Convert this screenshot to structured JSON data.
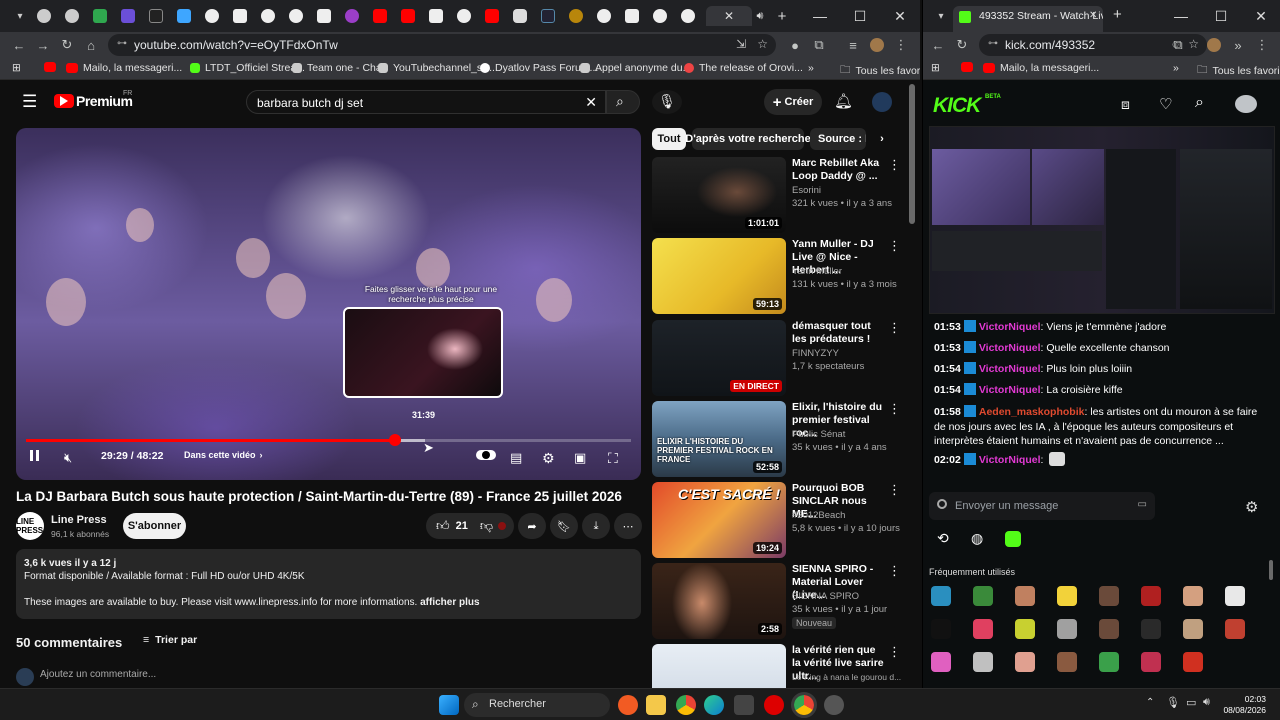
{
  "left_window": {
    "url": "youtube.com/watch?v=eOyTFdxOnTw",
    "bookmarks": [
      "Mailo, la messageri...",
      "LTDT_Officiel Strea...",
      "Team one - Chat",
      "YouTubechannel_sw...",
      "Dyatlov Pass Forum...",
      "Appel anonyme du...",
      "The release of Orovi...",
      "Tous les favoris"
    ]
  },
  "youtube": {
    "logo_label": "Premium",
    "region": "FR",
    "search_value": "barbara butch dj set",
    "create_label": "Créer",
    "video": {
      "drag_hint": "Faites glisser vers le haut pour une recherche plus précise",
      "preview_time": "31:39",
      "time": "29:29 / 48:22",
      "chapter_label": "Dans cette vidéo",
      "progress": 0.61,
      "hover": 0.66
    },
    "title": "La DJ Barbara Butch sous haute protection / Saint-Martin-du-Tertre (89) - France 25 juillet 2026",
    "channel": {
      "name": "Line Press",
      "subs": "96,1 k abonnés",
      "avatar_text": "LINE PRESS"
    },
    "subscribe_label": "S'abonner",
    "like_count": "21",
    "description": {
      "stats": "3,6 k vues  il y a 12 j",
      "line1": "Format disponible / Available format : Full HD ou/or UHD 4K/5K",
      "line2": "These images are available to buy. Please visit www.linepress.info for more informations.",
      "more": "afficher plus"
    },
    "comments_count": "50 commentaires",
    "sort_label": "Trier par",
    "add_comment": "Ajoutez un commentaire...",
    "chips": [
      "Tout",
      "D'après votre recherche",
      "Source : L"
    ],
    "recs": [
      {
        "title": "Marc Rebillet Aka Loop Daddy @ ...",
        "channel": "Esorini",
        "stats": "321 k vues • il y a 3 ans",
        "duration": "1:01:01",
        "badge": ""
      },
      {
        "title": "Yann Muller - DJ Live @ Nice - Herbert ...",
        "channel": "Yann Muller",
        "stats": "131 k vues • il y a 3 mois",
        "duration": "59:13",
        "badge": ""
      },
      {
        "title": "démasquer tout les prédateurs !",
        "channel": "FINNYZYY",
        "stats": "1,7 k spectateurs",
        "duration": "",
        "live": "EN DIRECT",
        "badge": ""
      },
      {
        "title": "Elixir, l'histoire du premier festival roc...",
        "channel": "Public Sénat",
        "stats": "35 k vues • il y a 4 ans",
        "duration": "52:58",
        "badge": "",
        "thumb_text": "ELIXIR L'HISTOIRE DU PREMIER FESTIVAL ROCK EN FRANCE"
      },
      {
        "title": "Pourquoi BOB SINCLAR nous ME...",
        "channel": "#2012Beach",
        "stats": "5,8 k vues • il y a 10 jours",
        "duration": "19:24",
        "badge": "",
        "thumb_text": "C'EST SACRÉ !"
      },
      {
        "title": "SIENNA SPIRO - Material Lover (Live...",
        "channel": "SIENNA SPIRO",
        "stats": "35 k vues • il y a 1 jour",
        "duration": "2:58",
        "badge": "Nouveau"
      },
      {
        "title": "la vérité rien que la vérité live sarire ultr...",
        "channel": "Le King à nana le gourou d...",
        "stats": "",
        "duration": "",
        "badge": ""
      }
    ]
  },
  "right_window": {
    "tab_title": "493352 Stream - Watch Live on",
    "url": "kick.com/493352",
    "bookmarks": [
      "Mailo, la messageri...",
      "Tous les favoris"
    ]
  },
  "kick": {
    "logo": "KICK",
    "logo_sup": "BETA",
    "chat": [
      {
        "time": "01:53",
        "user": "VictorNiquel",
        "text": "Viens je t'emmène j'adore",
        "color": "blue"
      },
      {
        "time": "01:53",
        "user": "VictorNiquel",
        "text": "Quelle excellente chanson",
        "color": "blue"
      },
      {
        "time": "01:54",
        "user": "VictorNiquel",
        "text": "Plus loin plus loiiin",
        "color": "blue"
      },
      {
        "time": "01:54",
        "user": "VictorNiquel",
        "text": "La croisière kiffe",
        "color": "blue"
      },
      {
        "time": "01:58",
        "user": "Aeden_maskophobik",
        "text": "les artistes ont du mouron à se faire de nos jours avec les IA , à l'époque les auteurs compositeurs et interprètes étaient humains et n'avaient pas de concurrence ...",
        "color": "red"
      },
      {
        "time": "02:02",
        "user": "VictorNiquel",
        "text": "",
        "color": "blue"
      }
    ],
    "input_placeholder": "Envoyer un message",
    "emote_section": "Fréquemment utilisés"
  },
  "taskbar": {
    "search_label": "Rechercher",
    "time": "02:03",
    "date": "08/08/2026"
  },
  "colors": {
    "yt_red": "#ff0000",
    "kick_green": "#53fc18",
    "bg": "#0f0f0f"
  }
}
